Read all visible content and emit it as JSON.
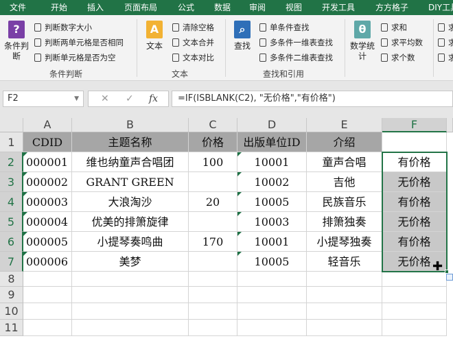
{
  "menu": [
    "文件",
    "开始",
    "插入",
    "页面布局",
    "公式",
    "数据",
    "审阅",
    "视图",
    "开发工具",
    "方方格子",
    "DIY工具"
  ],
  "ribbon": {
    "condition_button_label": "条件判\n断",
    "condition_items": [
      "判断数字大小",
      "判断两单元格是否相同",
      "判断单元格是否为空"
    ],
    "condition_group": "条件判断",
    "text_button_label": "文本",
    "text_items": [
      "清除空格",
      "文本合并",
      "文本对比"
    ],
    "text_group": "文本",
    "find_button_label": "查找",
    "find_items": [
      "单条件查找",
      "多条件一维表查找",
      "多条件二维表查找"
    ],
    "find_group": "查找和引用",
    "stats_button_label": "数学统\n计",
    "stats_items": [
      "求和",
      "求平均数",
      "求个数"
    ],
    "overflow_items": [
      "求",
      "求",
      "求"
    ]
  },
  "formula_bar": {
    "name_box": "F2",
    "fx_cancel": "✕",
    "fx_enter": "✓",
    "fx_label": "fx",
    "formula": "=IF(ISBLANK(C2), \"无价格\",\"有价格\")"
  },
  "columns": [
    "A",
    "B",
    "C",
    "D",
    "E",
    "F"
  ],
  "rows": [
    "1",
    "2",
    "3",
    "4",
    "5",
    "6",
    "7",
    "8",
    "9",
    "10",
    "11"
  ],
  "table": {
    "header": [
      "CDID",
      "主题名称",
      "价格",
      "出版单位ID",
      "介绍",
      ""
    ],
    "rows": [
      [
        "000001",
        "维也纳童声合唱团",
        "100",
        "10001",
        "童声合唱",
        "有价格"
      ],
      [
        "000002",
        "GRANT GREEN",
        "",
        "10002",
        "吉他",
        "无价格"
      ],
      [
        "000003",
        "大浪淘沙",
        "20",
        "10005",
        "民族音乐",
        "有价格"
      ],
      [
        "000004",
        "优美的排箫旋律",
        "",
        "10003",
        "排箫独奏",
        "无价格"
      ],
      [
        "000005",
        "小提琴奏鸣曲",
        "170",
        "10001",
        "小提琴独奏",
        "有价格"
      ],
      [
        "000006",
        "美梦",
        "",
        "10005",
        "轻音乐",
        "无价格"
      ]
    ]
  },
  "colors": {
    "accent": "#217346",
    "header_fill": "#a6a6a6",
    "selection_fill": "#c8c8c8"
  },
  "icons": {
    "fill_handle_cursor": "crosshair-icon",
    "autofill_options": "autofill-options-icon"
  }
}
